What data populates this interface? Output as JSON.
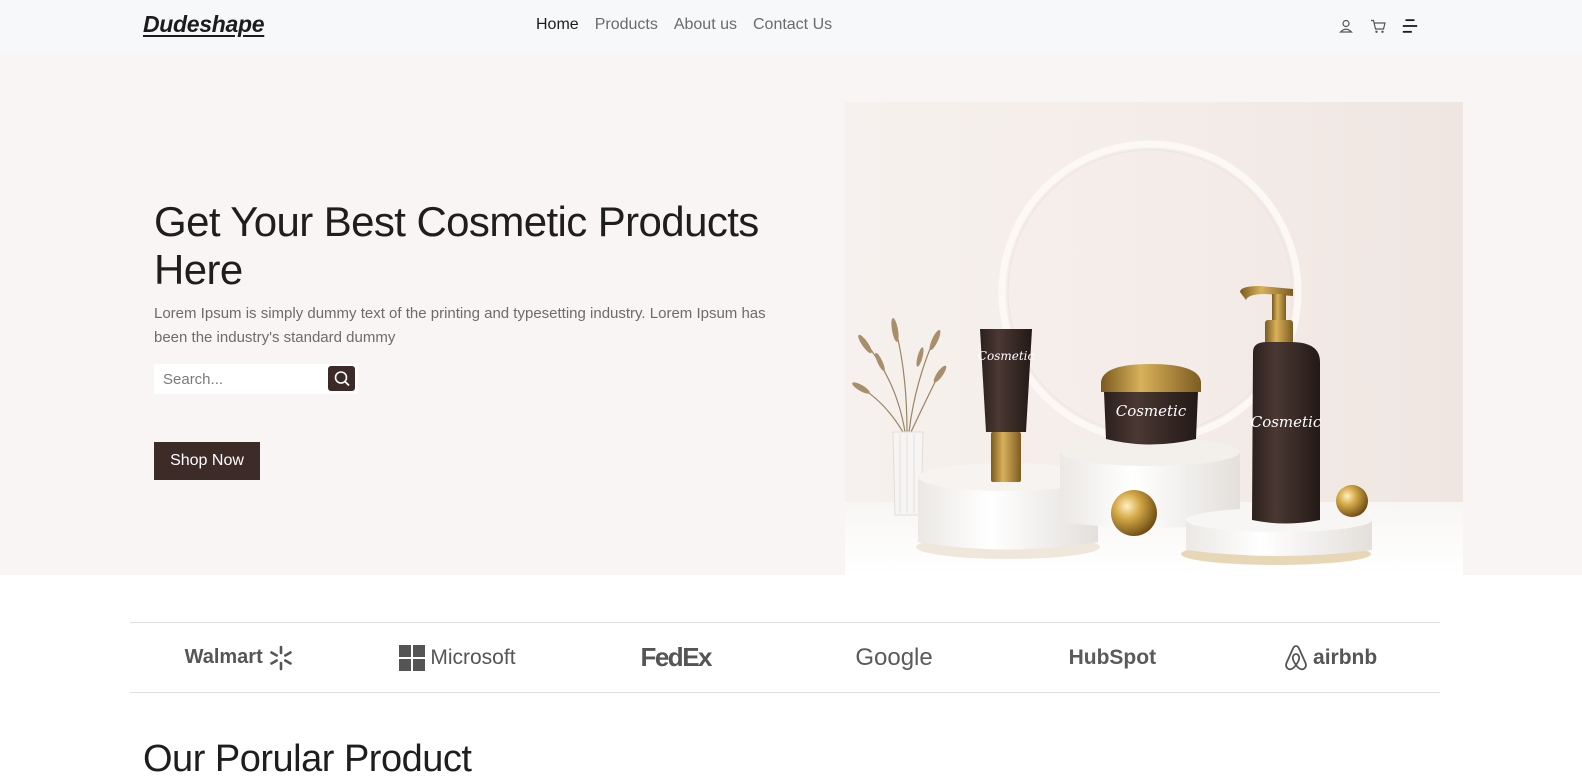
{
  "navbar": {
    "brand": "Dudeshape",
    "links": [
      {
        "label": "Home",
        "active": true
      },
      {
        "label": "Products",
        "active": false
      },
      {
        "label": "About us",
        "active": false
      },
      {
        "label": "Contact Us",
        "active": false
      }
    ],
    "icons": [
      "user-icon",
      "cart-icon",
      "menu-icon"
    ]
  },
  "hero": {
    "title": "Get Your Best Cosmetic Products Here",
    "description": "Lorem Ipsum is simply dummy text of the printing and typesetting industry. Lorem Ipsum has been the industry's standard dummy",
    "search_placeholder": "Search...",
    "cta_label": "Shop Now",
    "product_label": "Cosmetic"
  },
  "brands": [
    "Walmart",
    "Microsoft",
    "FedEx",
    "Google",
    "HubSpot",
    "airbnb"
  ],
  "popular": {
    "title": "Our Porular Product"
  },
  "colors": {
    "accent": "#3d2b28",
    "hero_bg": "#f9f5f4",
    "navbar_bg": "#f7f8fa",
    "gold": "#c9a24a"
  }
}
